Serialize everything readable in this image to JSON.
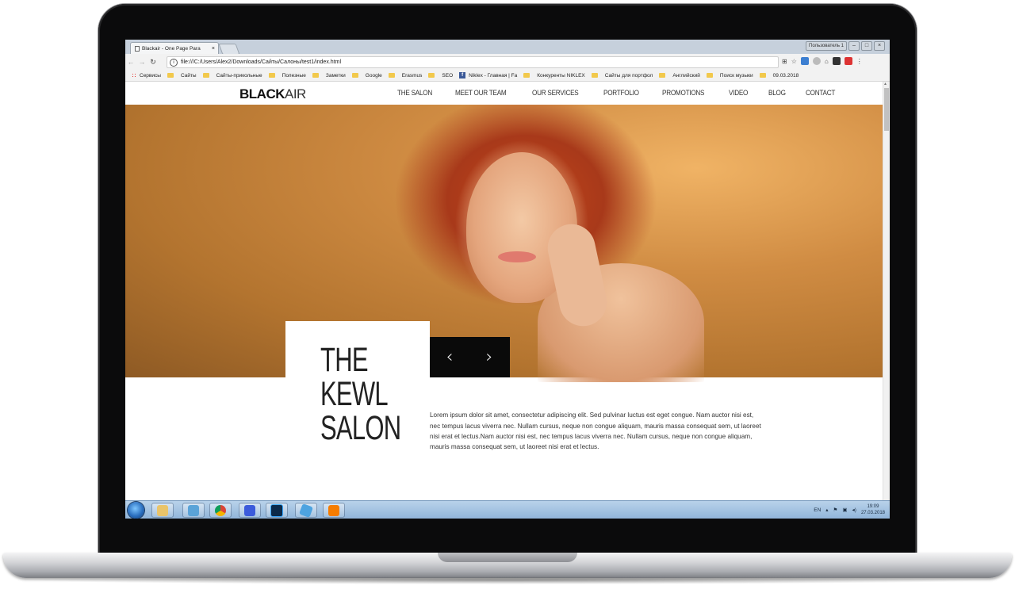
{
  "browser": {
    "tab_title": "Blackair - One Page Para",
    "tab_close": "×",
    "user_button": "Пользователь 1",
    "address": "file:///C:/Users/Alex2/Downloads/Сайты/Салоны/test1/index.html",
    "bookmarks": [
      "Сервисы",
      "Сайты",
      "Сайты-прикольные",
      "Полезные",
      "Заметки",
      "Google",
      "Erasmus",
      "SEO",
      "Niklex - Главная | Fa",
      "Конкуренты NIKLEX",
      "Сайты для портфол",
      "Английский",
      "Поиск музыки",
      "09.03.2018"
    ]
  },
  "site": {
    "logo_bold": "BLACK",
    "logo_thin": "AIR",
    "nav": [
      "THE SALON",
      "MEET OUR TEAM",
      "OUR SERVICES",
      "PORTFOLIO",
      "PROMOTIONS",
      "VIDEO",
      "BLOG",
      "CONTACT"
    ],
    "hero_title": [
      "THE",
      "KEWL",
      "SALON"
    ],
    "prev_arrow": "‹",
    "next_arrow": "›",
    "description": "Lorem ipsum dolor sit amet, consectetur adipiscing elit. Sed pulvinar luctus est eget congue. Nam auctor nisi est, nec tempus lacus viverra nec. Nullam cursus, neque non congue aliquam, mauris massa consequat sem, ut laoreet nisi erat et lectus.Nam auctor nisi est, nec tempus lacus viverra nec. Nullam cursus, neque non congue aliquam, mauris massa consequat sem, ut laoreet nisi erat et lectus."
  },
  "taskbar": {
    "language": "EN",
    "time": "19:09",
    "date": "27.03.2018"
  }
}
